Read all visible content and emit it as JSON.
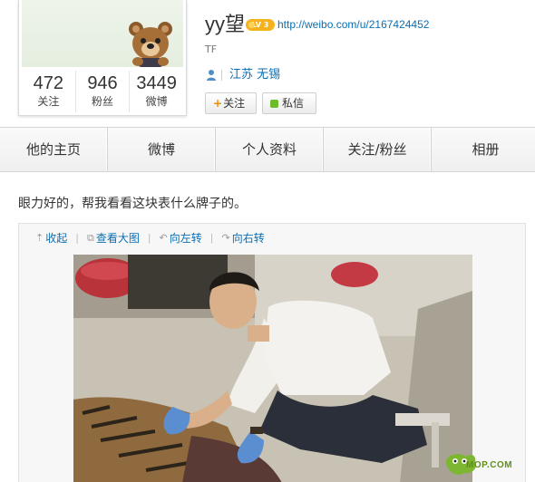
{
  "profile": {
    "username": "yy望",
    "vip_badge": "LV 3",
    "url": "http://weibo.com/u/2167424452",
    "tag": "TF",
    "location": "江苏 无锡",
    "stats": [
      {
        "num": "472",
        "label": "关注"
      },
      {
        "num": "946",
        "label": "粉丝"
      },
      {
        "num": "3449",
        "label": "微博"
      }
    ],
    "follow_label": "关注",
    "message_label": "私信"
  },
  "nav": {
    "tabs": [
      "他的主页",
      "微博",
      "个人资料",
      "关注/粉丝",
      "相册"
    ]
  },
  "post": {
    "text": "眼力好的，帮我看看这块表什么牌子的。",
    "toolbar": {
      "collapse": "收起",
      "view_large": "查看大图",
      "rotate_left": "向左转",
      "rotate_right": "向右转"
    }
  },
  "watermark": {
    "text": "MOP.COM"
  },
  "colors": {
    "link": "#0a6fb3",
    "badge": "#f4b21c",
    "msg_dot": "#6cbb2b",
    "follow_plus": "#f08a00"
  }
}
